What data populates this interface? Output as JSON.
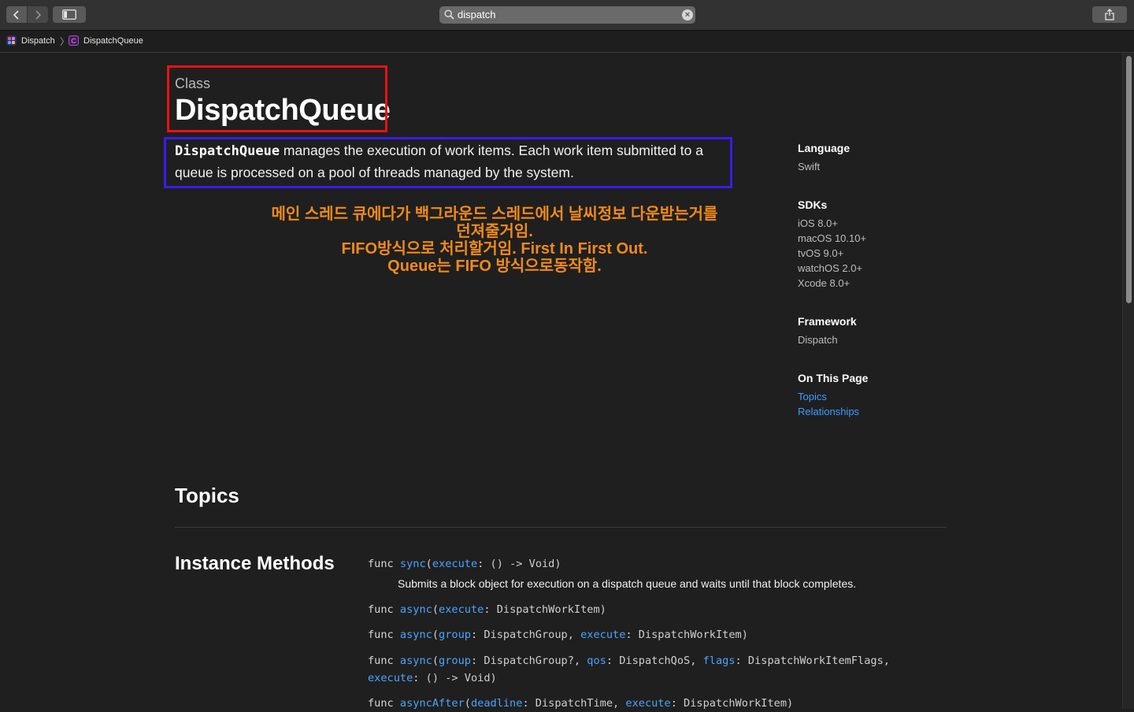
{
  "toolbar": {
    "search_query": "dispatch",
    "back_icon": "chevron-left-icon",
    "forward_icon": "chevron-right-icon",
    "sidebar_icon": "sidebar-icon",
    "share_icon": "share-icon"
  },
  "breadcrumb": {
    "items": [
      {
        "label": "Dispatch",
        "icon": "dispatch-framework-icon"
      },
      {
        "label": "DispatchQueue",
        "icon": "class-icon"
      }
    ],
    "separator": "〉"
  },
  "header": {
    "eyebrow": "Class",
    "title": "DispatchQueue"
  },
  "abstract": {
    "code": "DispatchQueue",
    "text_1": " manages the execution of work items. Each work item submitted to a",
    "text_2": "queue is processed on a pool of threads managed by the system."
  },
  "annotation": {
    "lines": [
      "메인 스레드 큐에다가 백그라운드 스레드에서 날씨정보 다운받는거를",
      "던져줄거임.",
      "FIFO방식으로 처리할거임. First In First Out.",
      "Queue는 FIFO 방식으로동작함."
    ],
    "color": "#f08a1a",
    "title_box_color": "#ee1111",
    "abstract_box_color": "#3a1bf0"
  },
  "aside": {
    "language": {
      "heading": "Language",
      "value": "Swift"
    },
    "sdks": {
      "heading": "SDKs",
      "values": [
        "iOS 8.0+",
        "macOS 10.10+",
        "tvOS 9.0+",
        "watchOS 2.0+",
        "Xcode 8.0+"
      ]
    },
    "framework": {
      "heading": "Framework",
      "value": "Dispatch"
    },
    "on_this_page": {
      "heading": "On This Page",
      "links": [
        "Topics",
        "Relationships"
      ]
    }
  },
  "topics": {
    "heading": "Topics",
    "section": "Instance Methods",
    "sync_description": "Submits a block object for execution on a dispatch queue and waits until that block completes."
  },
  "colors": {
    "background": "#1f1f1f",
    "link": "#3b9cff",
    "code_link": "#49a5ff"
  }
}
